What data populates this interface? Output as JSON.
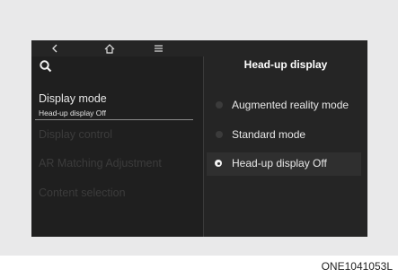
{
  "topbar": {
    "back_icon": "chevron-left-icon",
    "home_icon": "home-icon",
    "menu_icon": "hamburger-menu-icon"
  },
  "search_icon": "search-icon",
  "left_menu": {
    "items": [
      {
        "label": "Display mode",
        "sub": "Head-up display Off"
      },
      {
        "label": "Display control"
      },
      {
        "label": "AR Matching Adjustment"
      },
      {
        "label": "Content selection"
      }
    ]
  },
  "right_panel": {
    "title": "Head-up display",
    "options": [
      {
        "label": "Augmented reality mode",
        "selected": false
      },
      {
        "label": "Standard mode",
        "selected": false
      },
      {
        "label": "Head-up display Off",
        "selected": true
      }
    ]
  },
  "caption": "ONE1041053L"
}
